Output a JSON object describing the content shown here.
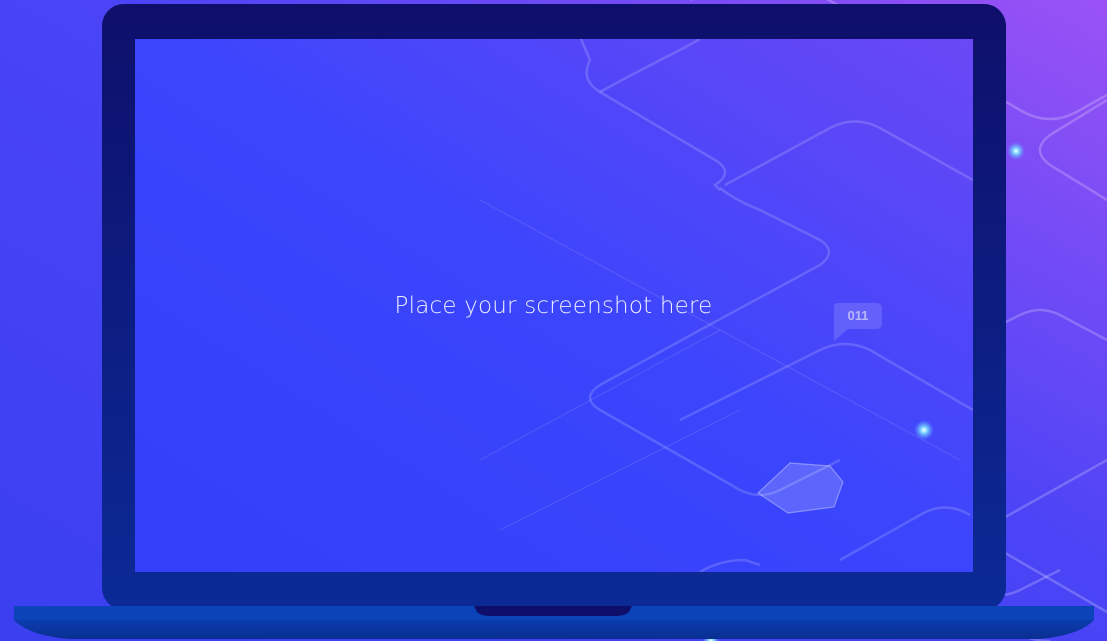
{
  "screen": {
    "placeholder_text": "Place your screenshot here"
  },
  "badge": {
    "text": "011"
  },
  "colors": {
    "background_start": "#3a3ff0",
    "background_end": "#9a52f5",
    "laptop_frame_top": "#0e0f6b",
    "laptop_frame_bottom": "#0b2a96",
    "screen_fill": "#3744fb",
    "glow_dot": "#6fd0ff"
  },
  "icons": {
    "badge": "speech-bubble-badge",
    "hexagon": "hexagon-decoration",
    "device": "laptop-mockup"
  }
}
